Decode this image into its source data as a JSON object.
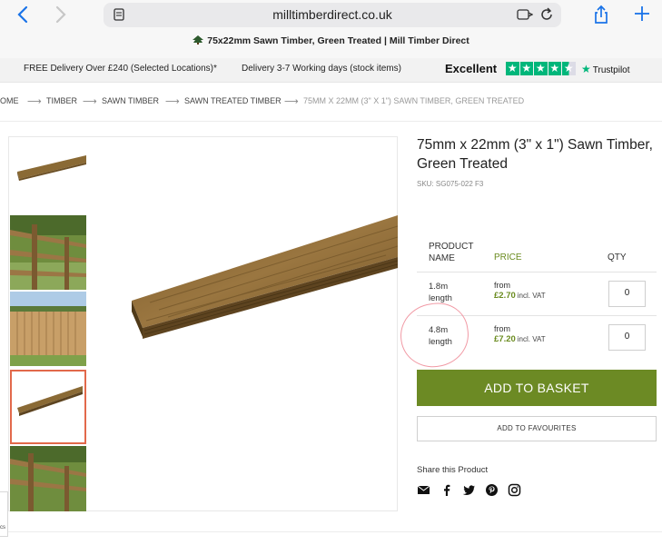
{
  "browser": {
    "url": "milltimberdirect.co.uk",
    "tab_title": "75x22mm Sawn Timber, Green Treated | Mill Timber Direct"
  },
  "infobar": {
    "delivery_free": "FREE Delivery Over £240 (Selected Locations)*",
    "delivery_time": "Delivery 3-7 Working days (stock items)",
    "rating_text": "Excellent",
    "trustpilot": "Trustpilot",
    "stars": 4.5,
    "trustpilot_color": "#00b67a"
  },
  "breadcrumb": {
    "items": [
      "OME",
      "TIMBER",
      "SAWN TIMBER",
      "SAWN TREATED TIMBER",
      "75MM X 22MM (3\" X 1\") SAWN TIMBER, GREEN TREATED"
    ]
  },
  "product": {
    "title": "75mm x 22mm (3\" x 1\") Sawn Timber, Green Treated",
    "sku": "SKU: SG075-022 F3",
    "table": {
      "col_name": "PRODUCT NAME",
      "col_price": "PRICE",
      "col_qty": "QTY",
      "rows": [
        {
          "name": "1.8m length",
          "from": "from",
          "price": "£2.70",
          "vat": "incl. VAT",
          "qty": "0"
        },
        {
          "name": "4.8m length",
          "from": "from",
          "price": "£7.20",
          "vat": "incl. VAT",
          "qty": "0"
        }
      ]
    },
    "add_to_basket": "ADD TO BASKET",
    "add_to_favourites": "ADD TO FAVOURITES",
    "share_label": "Share this Product",
    "accent_color": "#6c8a24"
  },
  "cookie": {
    "text": "cs"
  },
  "social_icons": [
    "email-icon",
    "facebook-icon",
    "twitter-icon",
    "pinterest-icon",
    "instagram-icon"
  ]
}
